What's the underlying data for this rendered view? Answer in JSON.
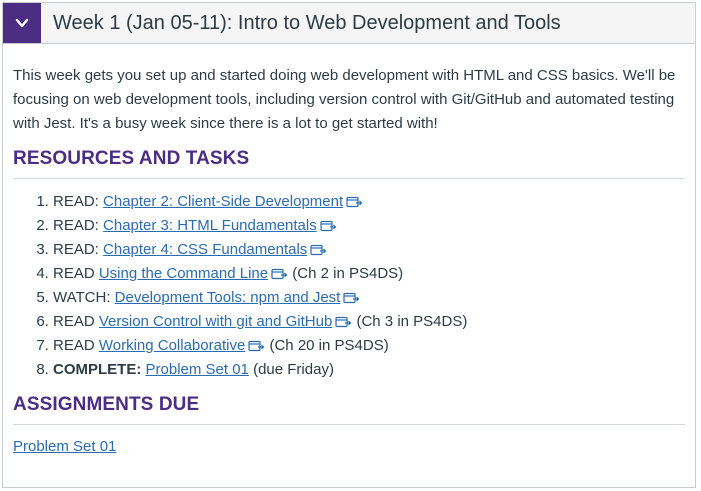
{
  "module": {
    "title": "Week 1 (Jan 05-11): Intro to Web Development and Tools",
    "intro": "This week gets you set up and started doing web development with HTML and CSS basics. We'll be focusing on web development tools, including version control with Git/GitHub and automated testing with Jest. It's a busy week since there is a lot to get started with!"
  },
  "resources": {
    "heading": "RESOURCES AND TASKS",
    "items": [
      {
        "prefix": "READ: ",
        "link": "Chapter 2: Client-Side Development",
        "suffix": ""
      },
      {
        "prefix": "READ: ",
        "link": "Chapter 3: HTML Fundamentals",
        "suffix": ""
      },
      {
        "prefix": "READ: ",
        "link": "Chapter 4: CSS Fundamentals",
        "suffix": ""
      },
      {
        "prefix": "READ ",
        "link": "Using the Command Line",
        "suffix": "(Ch 2 in PS4DS)"
      },
      {
        "prefix": "WATCH: ",
        "link": "Development Tools: npm and Jest",
        "suffix": ""
      },
      {
        "prefix": "READ ",
        "link": "Version Control with git and GitHub",
        "suffix": "(Ch 3 in PS4DS)"
      },
      {
        "prefix": "READ ",
        "link": "Working Collaborative",
        "suffix": "(Ch 20 in PS4DS)"
      },
      {
        "prefix": "COMPLETE:",
        "link": "Problem Set 01",
        "suffix": "(due Friday)"
      }
    ]
  },
  "assignments": {
    "heading": "ASSIGNMENTS DUE",
    "link": "Problem Set 01"
  },
  "colors": {
    "accent": "#4b2d84",
    "link": "#2b6cb0",
    "text": "#2d3b45"
  },
  "icons": {
    "toggle": "chevron-down-icon",
    "external": "external-link-icon"
  }
}
